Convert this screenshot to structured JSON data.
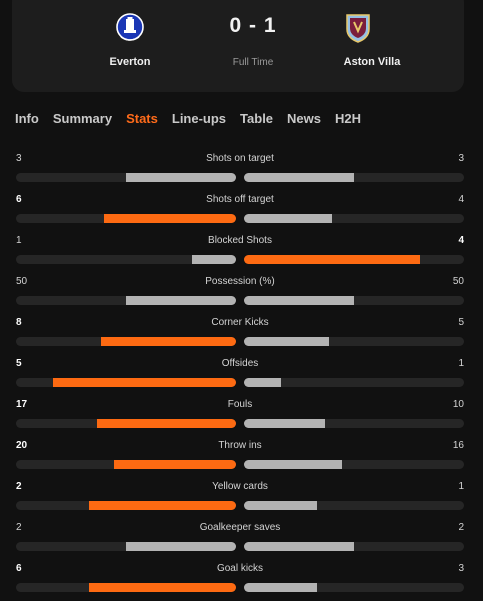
{
  "match": {
    "home_team": "Everton",
    "away_team": "Aston Villa",
    "score": "0 - 1",
    "status": "Full Time",
    "home_crest_icon": "everton-crest-icon",
    "away_crest_icon": "aston-villa-crest-icon"
  },
  "tabs": [
    "Info",
    "Summary",
    "Stats",
    "Line-ups",
    "Table",
    "News",
    "H2H"
  ],
  "active_tab": "Stats",
  "colors": {
    "accent": "#fd6a12",
    "neutral_bar": "#b3b3b3",
    "track": "#262626",
    "background": "#111111"
  },
  "stats": [
    {
      "label": "Shots on target",
      "home": "3",
      "away": "3",
      "home_share": 0.5,
      "away_share": 0.5,
      "home_leads": false,
      "away_leads": false
    },
    {
      "label": "Shots off target",
      "home": "6",
      "away": "4",
      "home_share": 0.6,
      "away_share": 0.4,
      "home_leads": true,
      "away_leads": false
    },
    {
      "label": "Blocked Shots",
      "home": "1",
      "away": "4",
      "home_share": 0.2,
      "away_share": 0.8,
      "home_leads": false,
      "away_leads": true
    },
    {
      "label": "Possession (%)",
      "home": "50",
      "away": "50",
      "home_share": 0.5,
      "away_share": 0.5,
      "home_leads": false,
      "away_leads": false
    },
    {
      "label": "Corner Kicks",
      "home": "8",
      "away": "5",
      "home_share": 0.615,
      "away_share": 0.385,
      "home_leads": true,
      "away_leads": false
    },
    {
      "label": "Offsides",
      "home": "5",
      "away": "1",
      "home_share": 0.833,
      "away_share": 0.167,
      "home_leads": true,
      "away_leads": false
    },
    {
      "label": "Fouls",
      "home": "17",
      "away": "10",
      "home_share": 0.63,
      "away_share": 0.37,
      "home_leads": true,
      "away_leads": false
    },
    {
      "label": "Throw ins",
      "home": "20",
      "away": "16",
      "home_share": 0.556,
      "away_share": 0.444,
      "home_leads": true,
      "away_leads": false
    },
    {
      "label": "Yellow cards",
      "home": "2",
      "away": "1",
      "home_share": 0.667,
      "away_share": 0.333,
      "home_leads": true,
      "away_leads": false
    },
    {
      "label": "Goalkeeper saves",
      "home": "2",
      "away": "2",
      "home_share": 0.5,
      "away_share": 0.5,
      "home_leads": false,
      "away_leads": false
    },
    {
      "label": "Goal kicks",
      "home": "6",
      "away": "3",
      "home_share": 0.667,
      "away_share": 0.333,
      "home_leads": true,
      "away_leads": false
    }
  ]
}
